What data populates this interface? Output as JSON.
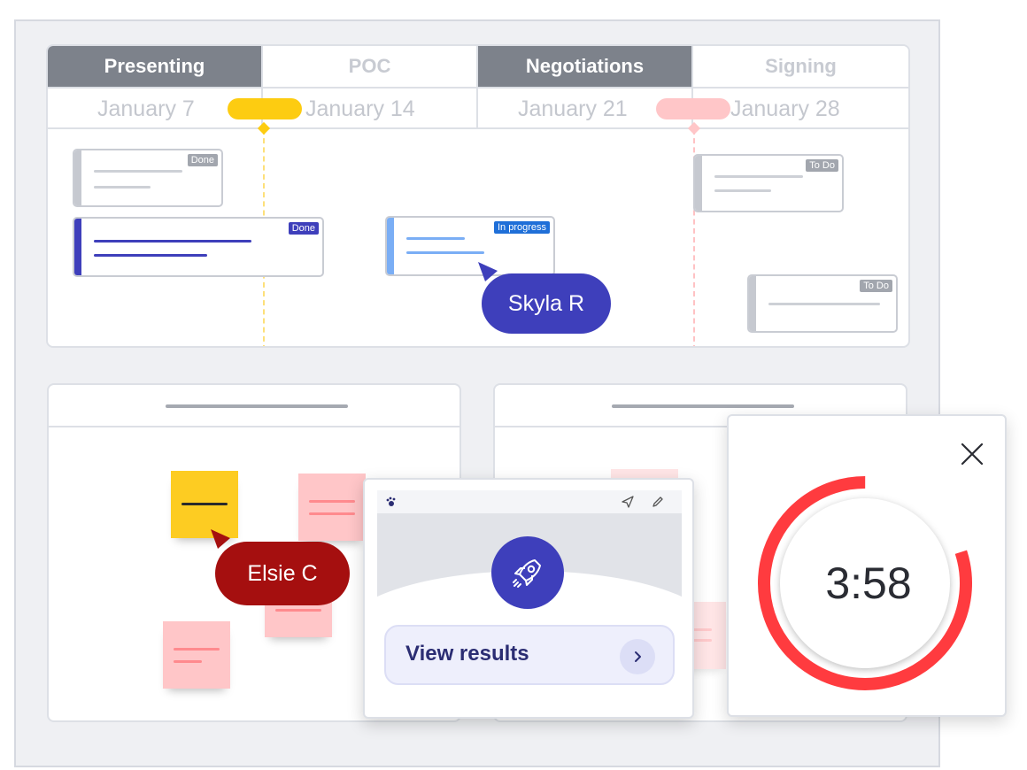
{
  "timeline": {
    "stages": [
      {
        "label": "Presenting",
        "style": "dark"
      },
      {
        "label": "POC",
        "style": "light"
      },
      {
        "label": "Negotiations",
        "style": "dark"
      },
      {
        "label": "Signing",
        "style": "light"
      }
    ],
    "dates": [
      "January 7",
      "January 14",
      "January 21",
      "January 28"
    ],
    "cards": [
      {
        "status": "Done",
        "color": "grey"
      },
      {
        "status": "Done",
        "color": "indigo"
      },
      {
        "status": "In progress",
        "color": "blue"
      },
      {
        "status": "To Do",
        "color": "grey"
      },
      {
        "status": "To Do",
        "color": "grey"
      }
    ]
  },
  "cursors": [
    {
      "name": "Skyla R",
      "color": "#3e3fbb"
    },
    {
      "name": "Elsie C",
      "color": "#a50f0f"
    }
  ],
  "results_popup": {
    "button_label": "View results",
    "icons": {
      "logo": "paw-icon",
      "send": "send-icon",
      "edit": "pencil-icon",
      "hero": "rocket-icon",
      "chevron": "chevron-right-icon"
    }
  },
  "timer": {
    "time": "3:58",
    "progress": 0.8,
    "accent": "#ff3b3f"
  },
  "colors": {
    "indigo": "#3e3fbb",
    "yellow": "#fdcc11",
    "pink": "#ffc6c8"
  }
}
